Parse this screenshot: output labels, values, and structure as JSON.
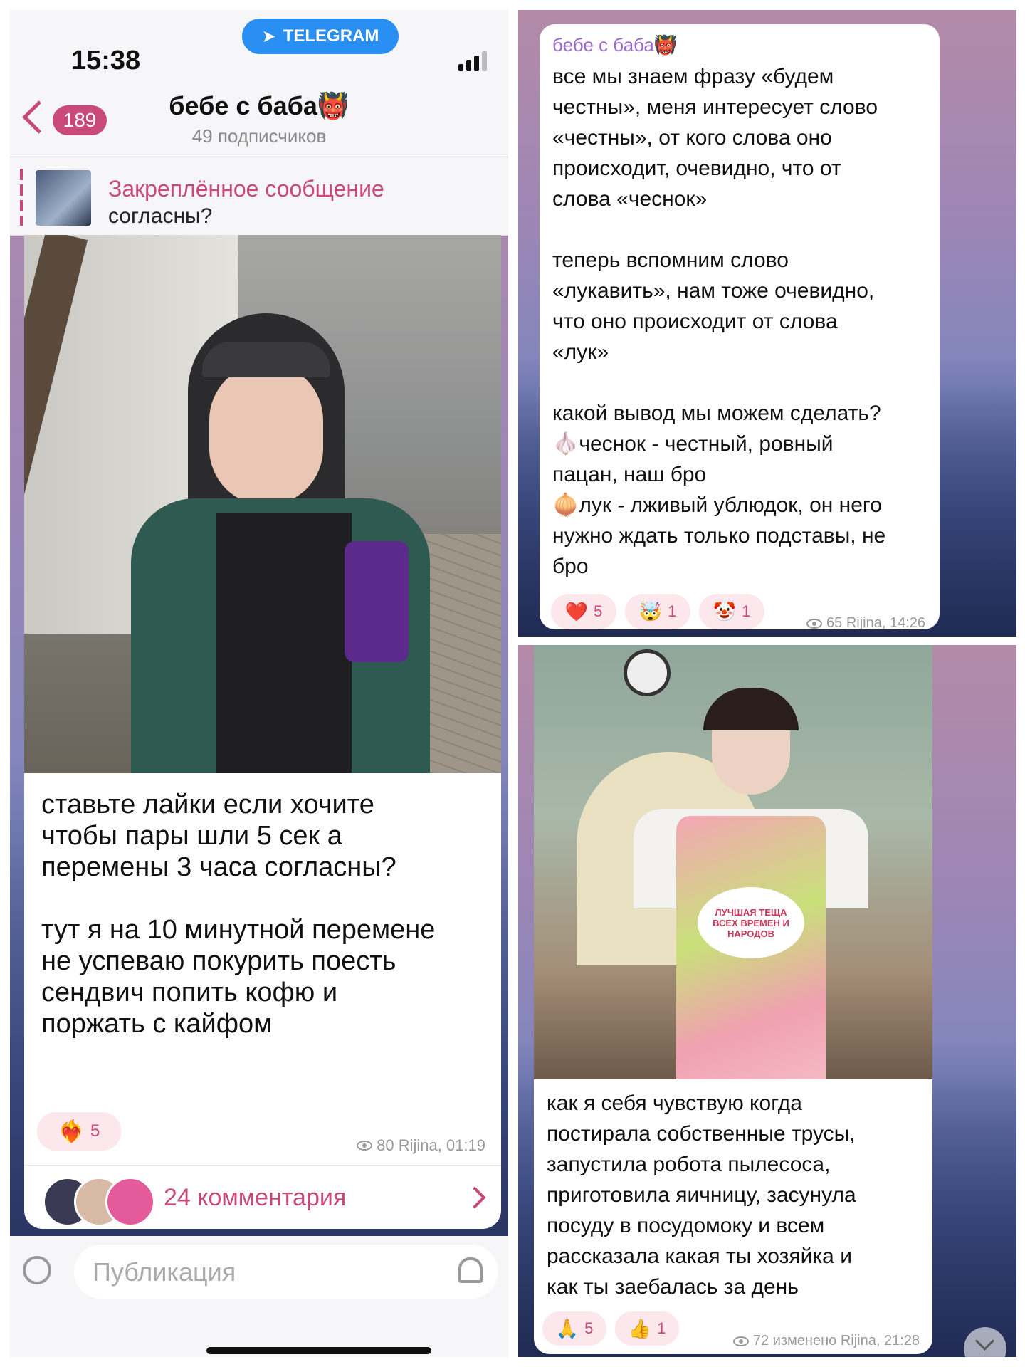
{
  "status": {
    "time": "15:38",
    "app_badge": "TELEGRAM"
  },
  "header": {
    "back_count": "189",
    "channel_title": "бебе с баба👹",
    "subscribers": "49 подписчиков"
  },
  "pinned": {
    "label": "Закреплённое сообщение",
    "text": "согласны?"
  },
  "post1": {
    "text": "ставьте лайки если хочите\nчтобы пары шли 5 сек а\nперемены 3 часа согласны?\n\nтут я на 10 минутной перемене\nне успеваю покурить поесть\nсендвич попить кофю и\nпоржать с кайфом",
    "reaction_emoji": "❤️‍🔥",
    "reaction_count": "5",
    "views_meta": "80 Rijina, 01:19",
    "comments": "24 комментария"
  },
  "composer": {
    "placeholder": "Публикация"
  },
  "post2": {
    "author": "бебе с баба👹",
    "text": "все мы знаем фразу «будем\nчестны», меня интересует слово\n«честны», от кого слова оно\nпроисходит, очевидно, что от\nслова «чеснок»\n\nтеперь вспомним слово\n«лукавить», нам тоже очевидно,\nчто оно происходит от слова\n«лук»\n\nкакой вывод мы можем сделать?\n🧄чеснок - честный, ровный\nпацан, наш бро\n🧅лук - лживый ублюдок, он него\nнужно ждать только подставы, не\nбро",
    "reactions": [
      {
        "emoji": "❤️",
        "count": "5"
      },
      {
        "emoji": "🤯",
        "count": "1"
      },
      {
        "emoji": "🤡",
        "count": "1"
      }
    ],
    "views_meta": "65 Rijina, 14:26"
  },
  "post3": {
    "apron_text": "ЛУЧШАЯ ТЕЩА ВСЕХ ВРЕМЕН И НАРОДОВ",
    "text": "как я себя чувствую когда\nпостирала собственные трусы,\nзапустила робота пылесоса,\nприготовила яичницу, засунула\nпосуду в посудомоку и всем\nрассказала какая ты хозяйка и\nкак ты заебалась за день",
    "reactions": [
      {
        "emoji": "🙏",
        "count": "5"
      },
      {
        "emoji": "👍",
        "count": "1"
      }
    ],
    "views_meta": "72 изменено Rijina, 21:28"
  }
}
